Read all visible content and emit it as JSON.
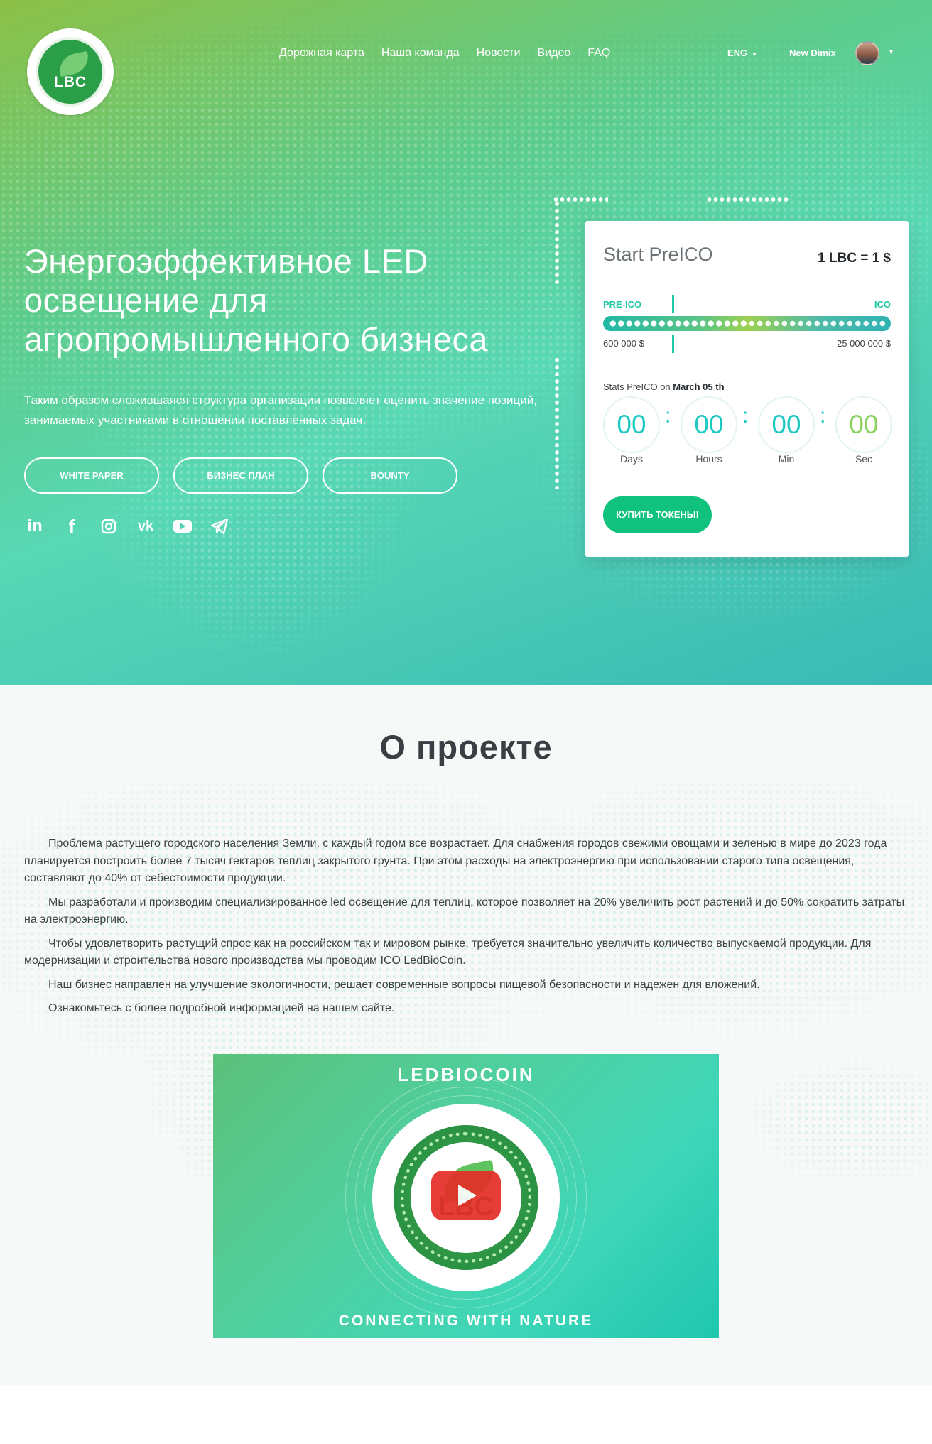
{
  "brand": {
    "logo_text": "LBC"
  },
  "nav": {
    "items": [
      {
        "label": "Дорожная карта"
      },
      {
        "label": "Наша команда"
      },
      {
        "label": "Новости"
      },
      {
        "label": "Видео"
      },
      {
        "label": "FAQ"
      }
    ],
    "language": "ENG",
    "user_name": "New Dimix"
  },
  "hero": {
    "title": "Энергоэффективное LED освещение для агропромышленного бизнеса",
    "subtitle": "Таким образом сложившаяся структура организации позволяет оценить значение позиций, занимаемых участниками в отношении поставленных задач.",
    "buttons": {
      "white_paper": "WHITE PAPER",
      "business_plan": "БИЗНЕС ПЛАН",
      "bounty": "BOUNTY"
    },
    "socials": [
      "linkedin-icon",
      "facebook-icon",
      "instagram-icon",
      "vk-icon",
      "youtube-icon",
      "telegram-icon"
    ]
  },
  "preico_card": {
    "title": "Start PreICO",
    "rate": "1 LBC = 1 $",
    "label_preico": "PRE-ICO",
    "label_ico": "ICO",
    "amount_min": "600 000 $",
    "amount_max": "25 000 000 $",
    "progress_fraction": 0.5,
    "stats_prefix": "Stats PreICO on",
    "stats_date": "March 05 th",
    "countdown": [
      {
        "value": "00",
        "unit": "Days"
      },
      {
        "value": "00",
        "unit": "Hours"
      },
      {
        "value": "00",
        "unit": "Min"
      },
      {
        "value": "00",
        "unit": "Sec"
      }
    ],
    "buy_label": "КУПИТЬ ТОКЕНЫ!"
  },
  "about": {
    "title": "О проекте",
    "paragraphs": [
      "Проблема растущего городского населения Земли, с каждый годом все возрастает. Для снабжения городов свежими овощами и зеленью в мире до 2023 года планируется построить более 7 тысяч гектаров теплиц закрытого грунта. При этом расходы на электроэнергию при использовании старого типа освещения, составляют до 40% от себестоимости продукции.",
      "Мы разработали и производим специализированное led освещение для теплиц, которое позволяет на 20% увеличить рост растений и до 50% сократить затраты на электроэнергию.",
      "Чтобы удовлетворить растущий спрос как на российском так и мировом рынке, требуется значительно увеличить количество выпускаемой продукции. Для модернизации и строительства нового производства мы проводим ICO LedBioCoin.",
      "Наш бизнес направлен на улучшение экологичности, решает современные вопросы пищевой безопасности и надежен для вложений.",
      "Ознакомьтесь с более подробной информацией на нашем сайте."
    ],
    "video": {
      "brand": "LEDBIOCOIN",
      "logo_text": "LBC",
      "tagline": "CONNECTING WITH NATURE"
    }
  },
  "colors": {
    "accent_teal": "#1fc9a3",
    "buy_green": "#11c27f",
    "play_red": "#e52d27"
  }
}
